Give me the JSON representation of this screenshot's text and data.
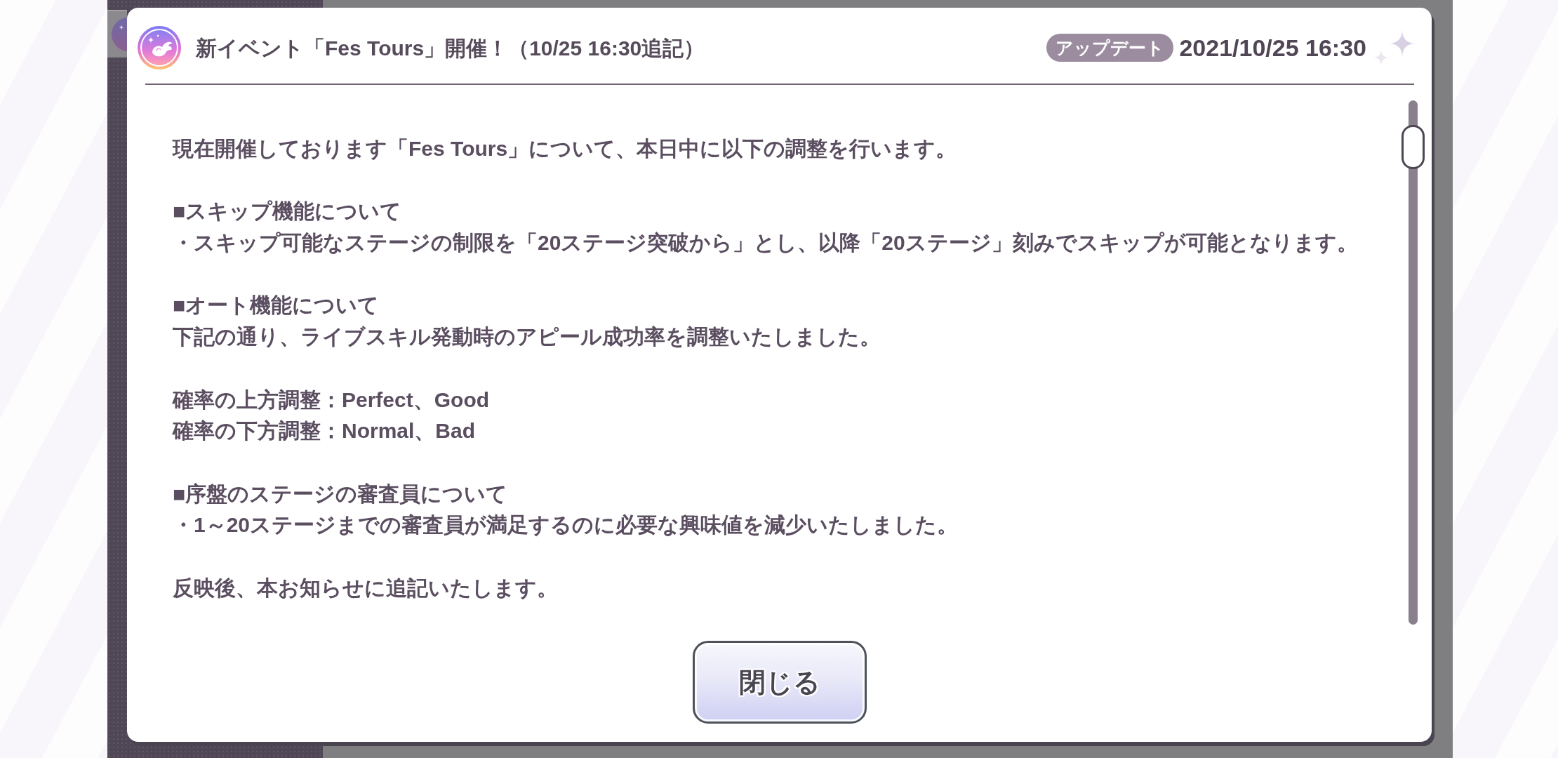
{
  "header": {
    "title": "新イベント「Fes Tours」開催！（10/25 16:30追記）",
    "badge": "アップデート",
    "date": "2021/10/25 16:30"
  },
  "body": {
    "paragraphs": [
      [
        "現在開催しております「Fes Tours」について、本日中に以下の調整を行います。"
      ],
      [
        "■スキップ機能について",
        "・スキップ可能なステージの制限を「20ステージ突破から」とし、以降「20ステージ」刻みでスキップが可能となります。"
      ],
      [
        "■オート機能について",
        "下記の通り、ライブスキル発動時のアピール成功率を調整いたしました。"
      ],
      [
        "確率の上方調整：Perfect、Good",
        "確率の下方調整：Normal、Bad"
      ],
      [
        "■序盤のステージの審査員について",
        "・1～20ステージまでの審査員が満足するのに必要な興味値を減少いたしました。"
      ],
      [
        "反映後、本お知らせに追記いたします。"
      ]
    ]
  },
  "footer": {
    "button": "閉じる"
  }
}
